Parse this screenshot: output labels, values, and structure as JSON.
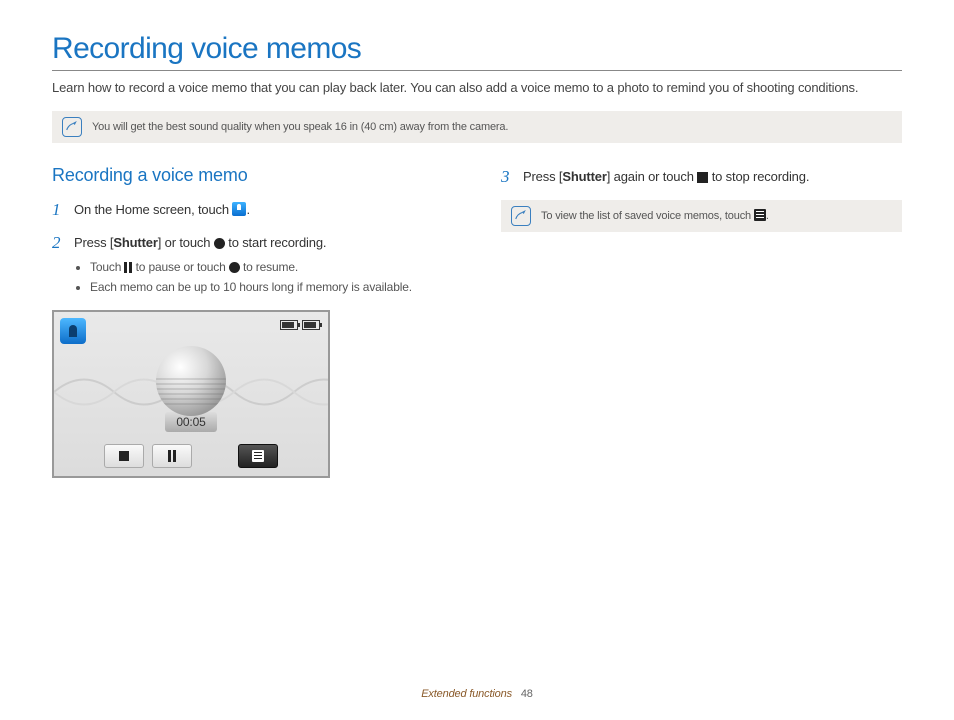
{
  "title": "Recording voice memos",
  "intro": "Learn how to record a voice memo that you can play back later. You can also add a voice memo to a photo to remind you of shooting conditions.",
  "top_note": "You will get the best sound quality when you speak 16 in (40 cm) away from the camera.",
  "subtitle": "Recording a voice memo",
  "steps": {
    "s1": {
      "num": "1",
      "a": "On the Home screen, touch ",
      "b": "."
    },
    "s2": {
      "num": "2",
      "a": "Press [",
      "shutter": "Shutter",
      "b": "] or touch ",
      "c": " to start recording.",
      "sub1a": "Touch ",
      "sub1b": " to pause or touch ",
      "sub1c": " to resume.",
      "sub2": "Each memo can be up to 10 hours long if memory is available."
    },
    "s3": {
      "num": "3",
      "a": "Press [",
      "shutter": "Shutter",
      "b": "] again or touch ",
      "c": " to stop recording."
    }
  },
  "right_note_a": "To view the list of saved voice memos, touch ",
  "right_note_b": ".",
  "device_timer": "00:05",
  "footer_section": "Extended functions",
  "footer_page": "48"
}
